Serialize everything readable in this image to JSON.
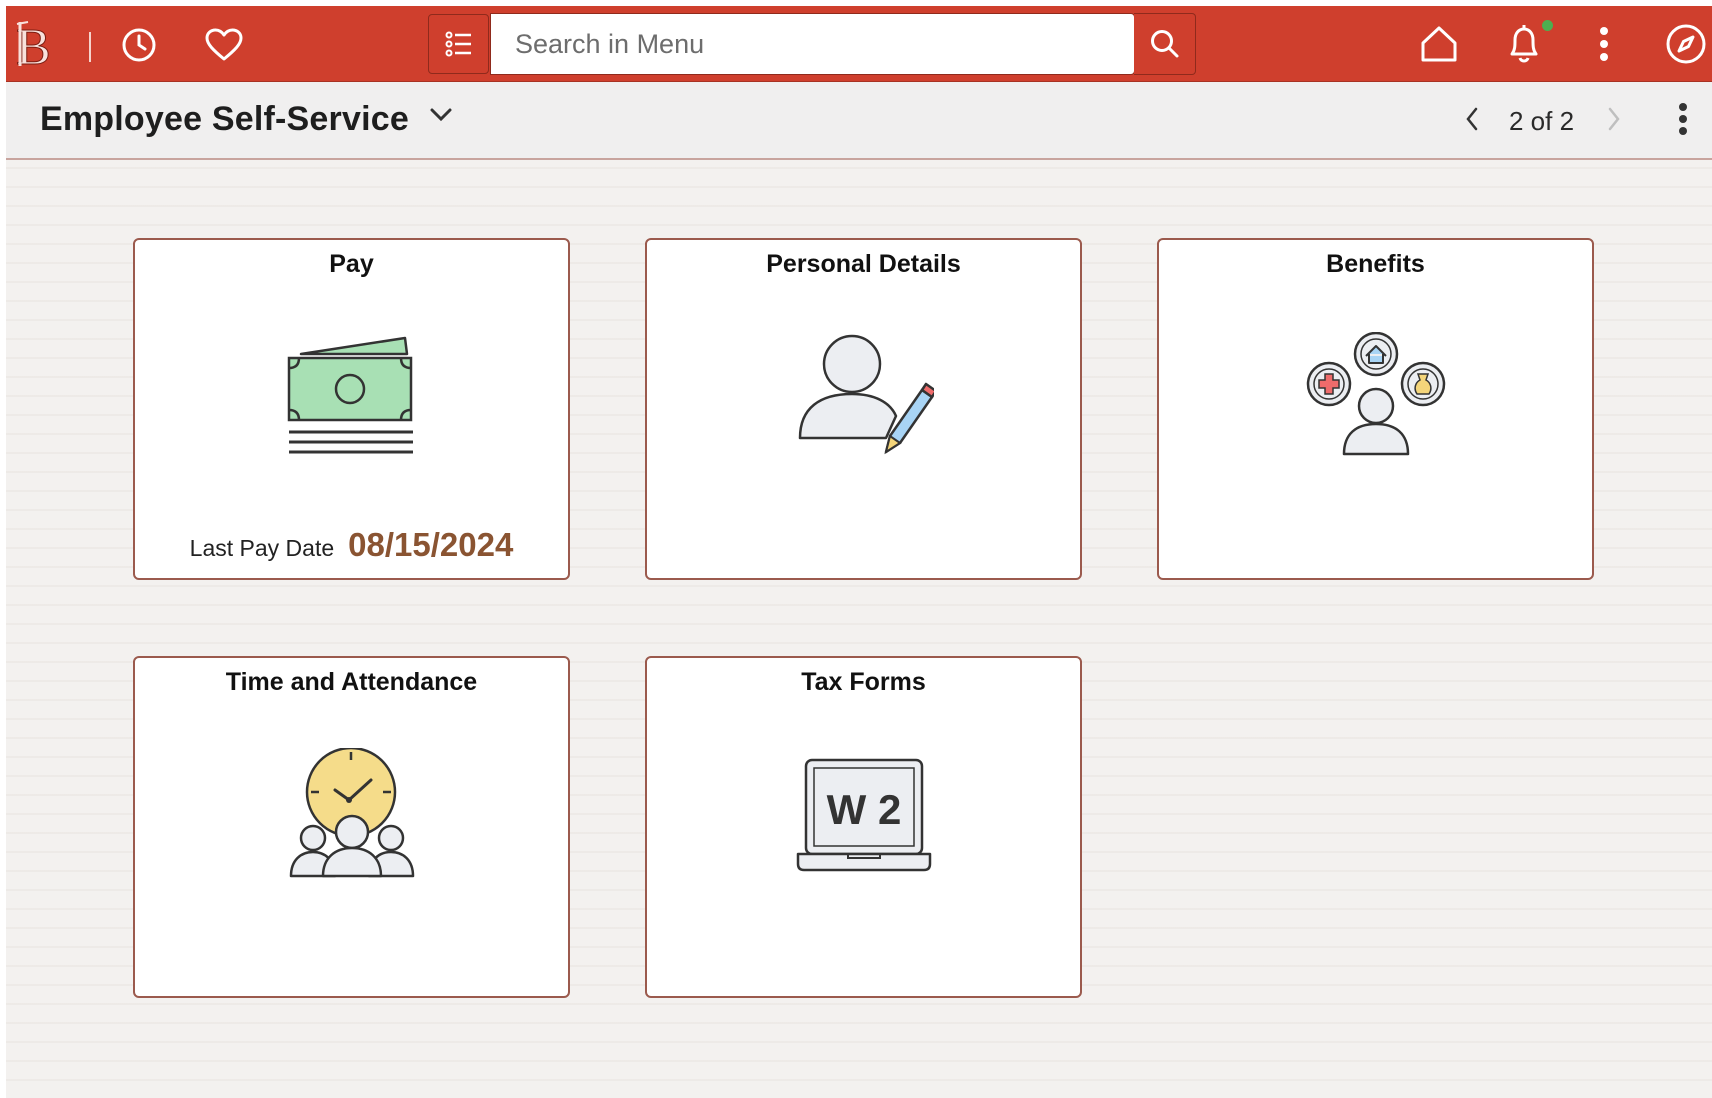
{
  "banner": {
    "search_placeholder": "Search in Menu",
    "brand_color": "#cf3f2d",
    "notification_indicator_color": "#4caf50"
  },
  "page_header": {
    "title": "Employee Self-Service",
    "pager_text": "2 of 2"
  },
  "tiles": [
    {
      "title": "Pay",
      "footer_label": "Last Pay Date",
      "footer_value": "08/15/2024",
      "icon": "money-icon"
    },
    {
      "title": "Personal Details",
      "icon": "person-edit-icon"
    },
    {
      "title": "Benefits",
      "icon": "benefits-icon"
    },
    {
      "title": "Time and Attendance",
      "icon": "clock-people-icon"
    },
    {
      "title": "Tax Forms",
      "icon": "w2-laptop-icon",
      "icon_text": "W 2"
    }
  ]
}
